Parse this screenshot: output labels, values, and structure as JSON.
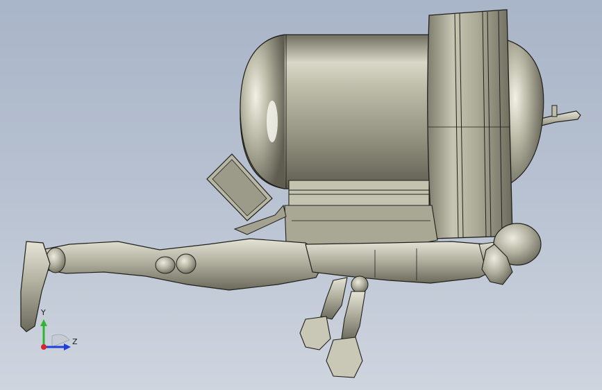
{
  "viewport": {
    "background_top": "#a9b5c8",
    "background_bottom": "#cfd5df"
  },
  "model": {
    "parts": [
      "jetpack-tank",
      "tank-end-cap-ring",
      "handle-bar",
      "control-panel",
      "tank-base-bracket",
      "mannequin-figure"
    ],
    "metal_color": "#b9b8a6",
    "edge_color": "#1f1f1a"
  },
  "triad": {
    "y_label": "Y",
    "z_label": "Z",
    "y_color": "#2fb52f",
    "z_color": "#1f3fd8",
    "x_color": "#d8262f"
  }
}
